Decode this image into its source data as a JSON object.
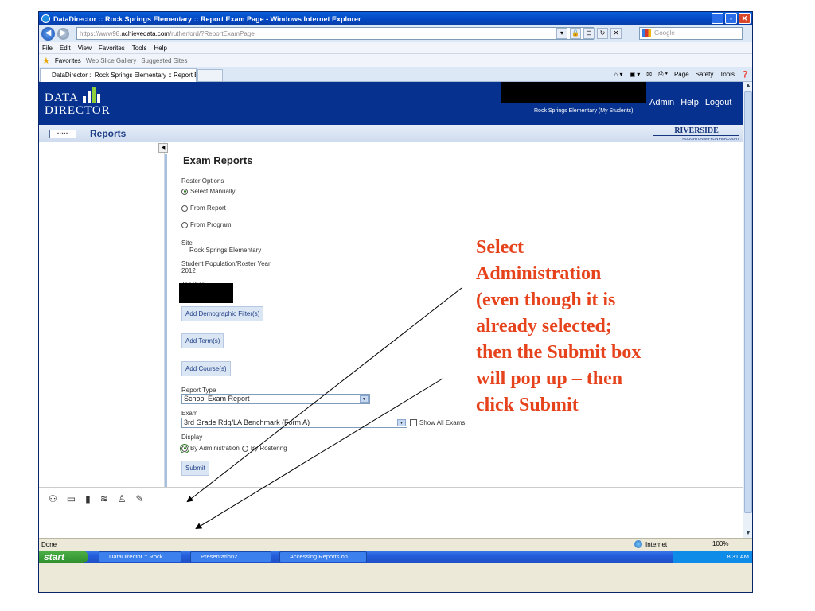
{
  "window": {
    "title": "DataDirector :: Rock Springs Elementary :: Report Exam Page - Windows Internet Explorer"
  },
  "address_bar": {
    "url_prefix": "https://www98.",
    "url_domain": "achievedata.com",
    "url_path": "/rutherford/?ReportExamPage",
    "search_placeholder": "Google"
  },
  "menu": [
    "File",
    "Edit",
    "View",
    "Favorites",
    "Tools",
    "Help"
  ],
  "favorites_bar": {
    "favorites": "Favorites",
    "web_slice": "Web Slice Gallery",
    "suggested": "Suggested Sites"
  },
  "tab": {
    "label": "DataDirector :: Rock Springs Elementary :: Report Ex..."
  },
  "command_bar": {
    "page": "Page",
    "safety": "Safety",
    "tools": "Tools"
  },
  "app_header": {
    "logo_line1": "DATA",
    "logo_line2": "DIRECTOR",
    "school": "Rock Springs Elementary (My Students)",
    "links": [
      "Admin",
      "Help",
      "Logout"
    ],
    "section": "Reports",
    "brand": "RIVERSIDE",
    "brand_sub": "HOUGHTON MIFFLIN HARCOURT"
  },
  "form": {
    "title": "Exam Reports",
    "roster_label": "Roster Options",
    "roster_options": [
      "Select Manually",
      "From Report",
      "From Program"
    ],
    "roster_selected": "Select Manually",
    "site_label": "Site",
    "site_value": "Rock Springs Elementary",
    "year_label": "Student Population/Roster Year",
    "year_value": "2012",
    "teacher_label": "Teacher",
    "btn_demographic": "Add Demographic Filter(s)",
    "btn_term": "Add Term(s)",
    "btn_course": "Add Course(s)",
    "report_type_label": "Report Type",
    "report_type_value": "School Exam Report",
    "exam_label": "Exam",
    "exam_value": "3rd Grade Rdg/LA Benchmark (Form A)",
    "show_all": "Show All Exams",
    "display_label": "Display",
    "display_options": [
      "By Administration",
      "By Rostering"
    ],
    "display_selected": "By Administration",
    "submit": "Submit"
  },
  "annotation": {
    "lines": [
      "Select",
      "Administration",
      "(even though it is",
      "already selected;",
      "then the Submit box",
      "will pop up – then",
      "click Submit"
    ],
    "color": "#e6431d"
  },
  "status": {
    "left": "Done",
    "zone": "Internet",
    "zoom": "100%"
  },
  "taskbar": {
    "start": "start",
    "items": [
      "DataDirector :: Rock ...",
      "Presentation2",
      "Accessing Reports on..."
    ],
    "clock": "8:31 AM"
  },
  "colors": {
    "header_blue": "#06318f",
    "annotation_red": "#e6431d"
  }
}
